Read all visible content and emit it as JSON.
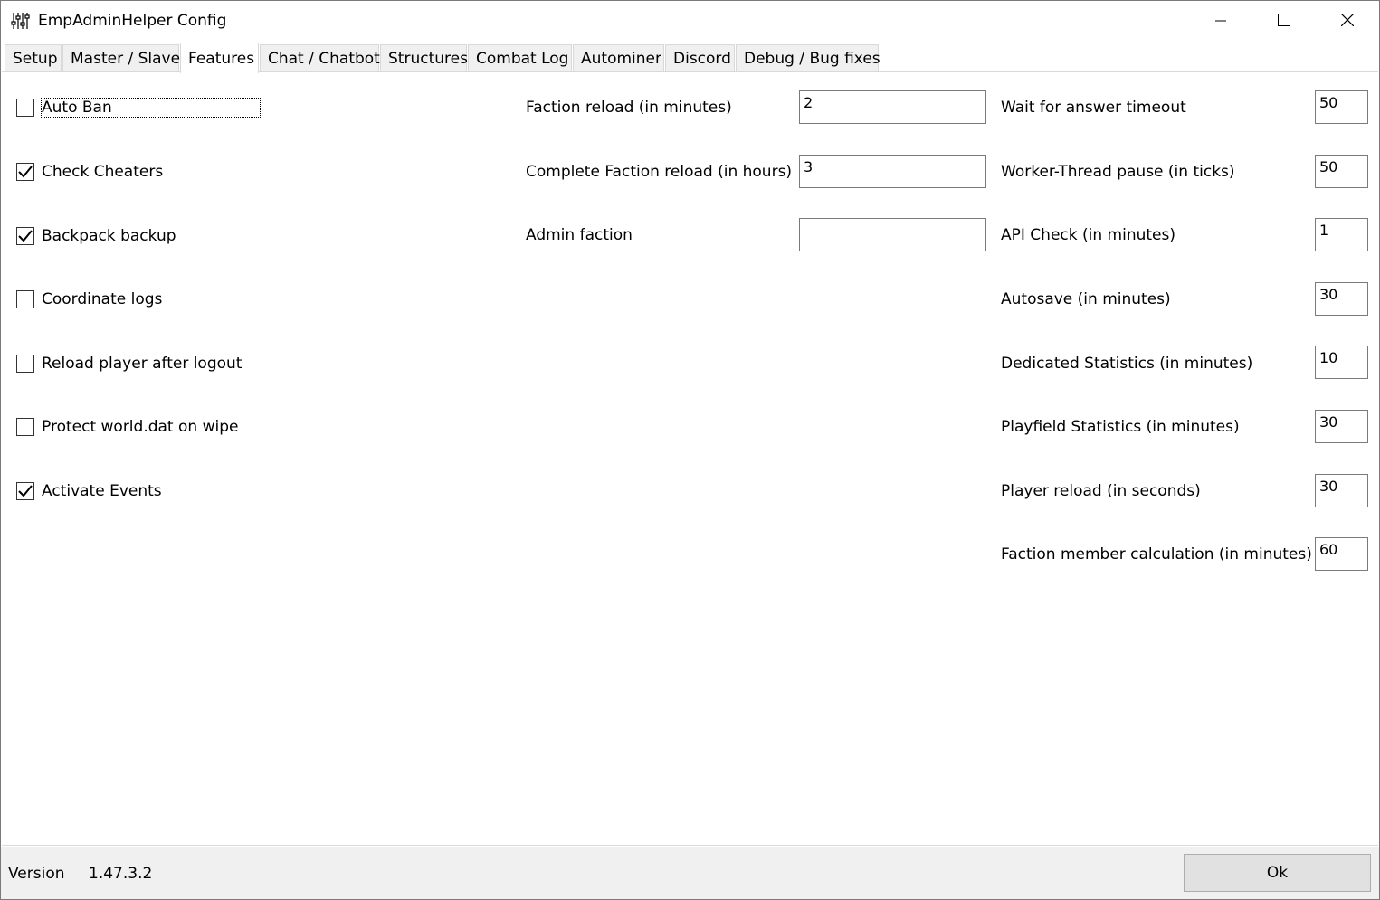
{
  "window": {
    "title": "EmpAdminHelper Config"
  },
  "tabs": [
    {
      "label": "Setup",
      "active": false
    },
    {
      "label": "Master / Slave",
      "active": false
    },
    {
      "label": "Features",
      "active": true
    },
    {
      "label": "Chat / Chatbot",
      "active": false
    },
    {
      "label": "Structures",
      "active": false
    },
    {
      "label": "Combat Log",
      "active": false
    },
    {
      "label": "Autominer",
      "active": false
    },
    {
      "label": "Discord",
      "active": false
    },
    {
      "label": "Debug / Bug fixes",
      "active": false
    }
  ],
  "features": {
    "checkboxes": [
      {
        "label": "Auto Ban",
        "checked": false
      },
      {
        "label": "Check Cheaters",
        "checked": true
      },
      {
        "label": "Backpack backup",
        "checked": true
      },
      {
        "label": "Coordinate logs",
        "checked": false
      },
      {
        "label": "Reload player after logout",
        "checked": false
      },
      {
        "label": "Protect world.dat on wipe",
        "checked": false
      },
      {
        "label": "Activate Events",
        "checked": true
      }
    ],
    "middle_fields": [
      {
        "label": "Faction reload (in minutes)",
        "value": "2"
      },
      {
        "label": "Complete Faction reload (in hours)",
        "value": "3"
      },
      {
        "label": "Admin faction",
        "value": ""
      }
    ],
    "right_fields": [
      {
        "label": "Wait for answer timeout",
        "value": "50"
      },
      {
        "label": "Worker-Thread pause (in ticks)",
        "value": "50"
      },
      {
        "label": "API Check (in minutes)",
        "value": "1"
      },
      {
        "label": "Autosave (in minutes)",
        "value": "30"
      },
      {
        "label": "Dedicated Statistics (in minutes)",
        "value": "10"
      },
      {
        "label": "Playfield Statistics (in minutes)",
        "value": "30"
      },
      {
        "label": "Player reload (in seconds)",
        "value": "30"
      },
      {
        "label": "Faction member calculation (in minutes)",
        "value": "60"
      }
    ]
  },
  "footer": {
    "version_label": "Version",
    "version_value": "1.47.3.2",
    "ok_label": "Ok"
  },
  "colors": {
    "tab_bg": "#f0f0f0",
    "border": "#d9d9d9",
    "button_bg": "#e1e1e1"
  }
}
